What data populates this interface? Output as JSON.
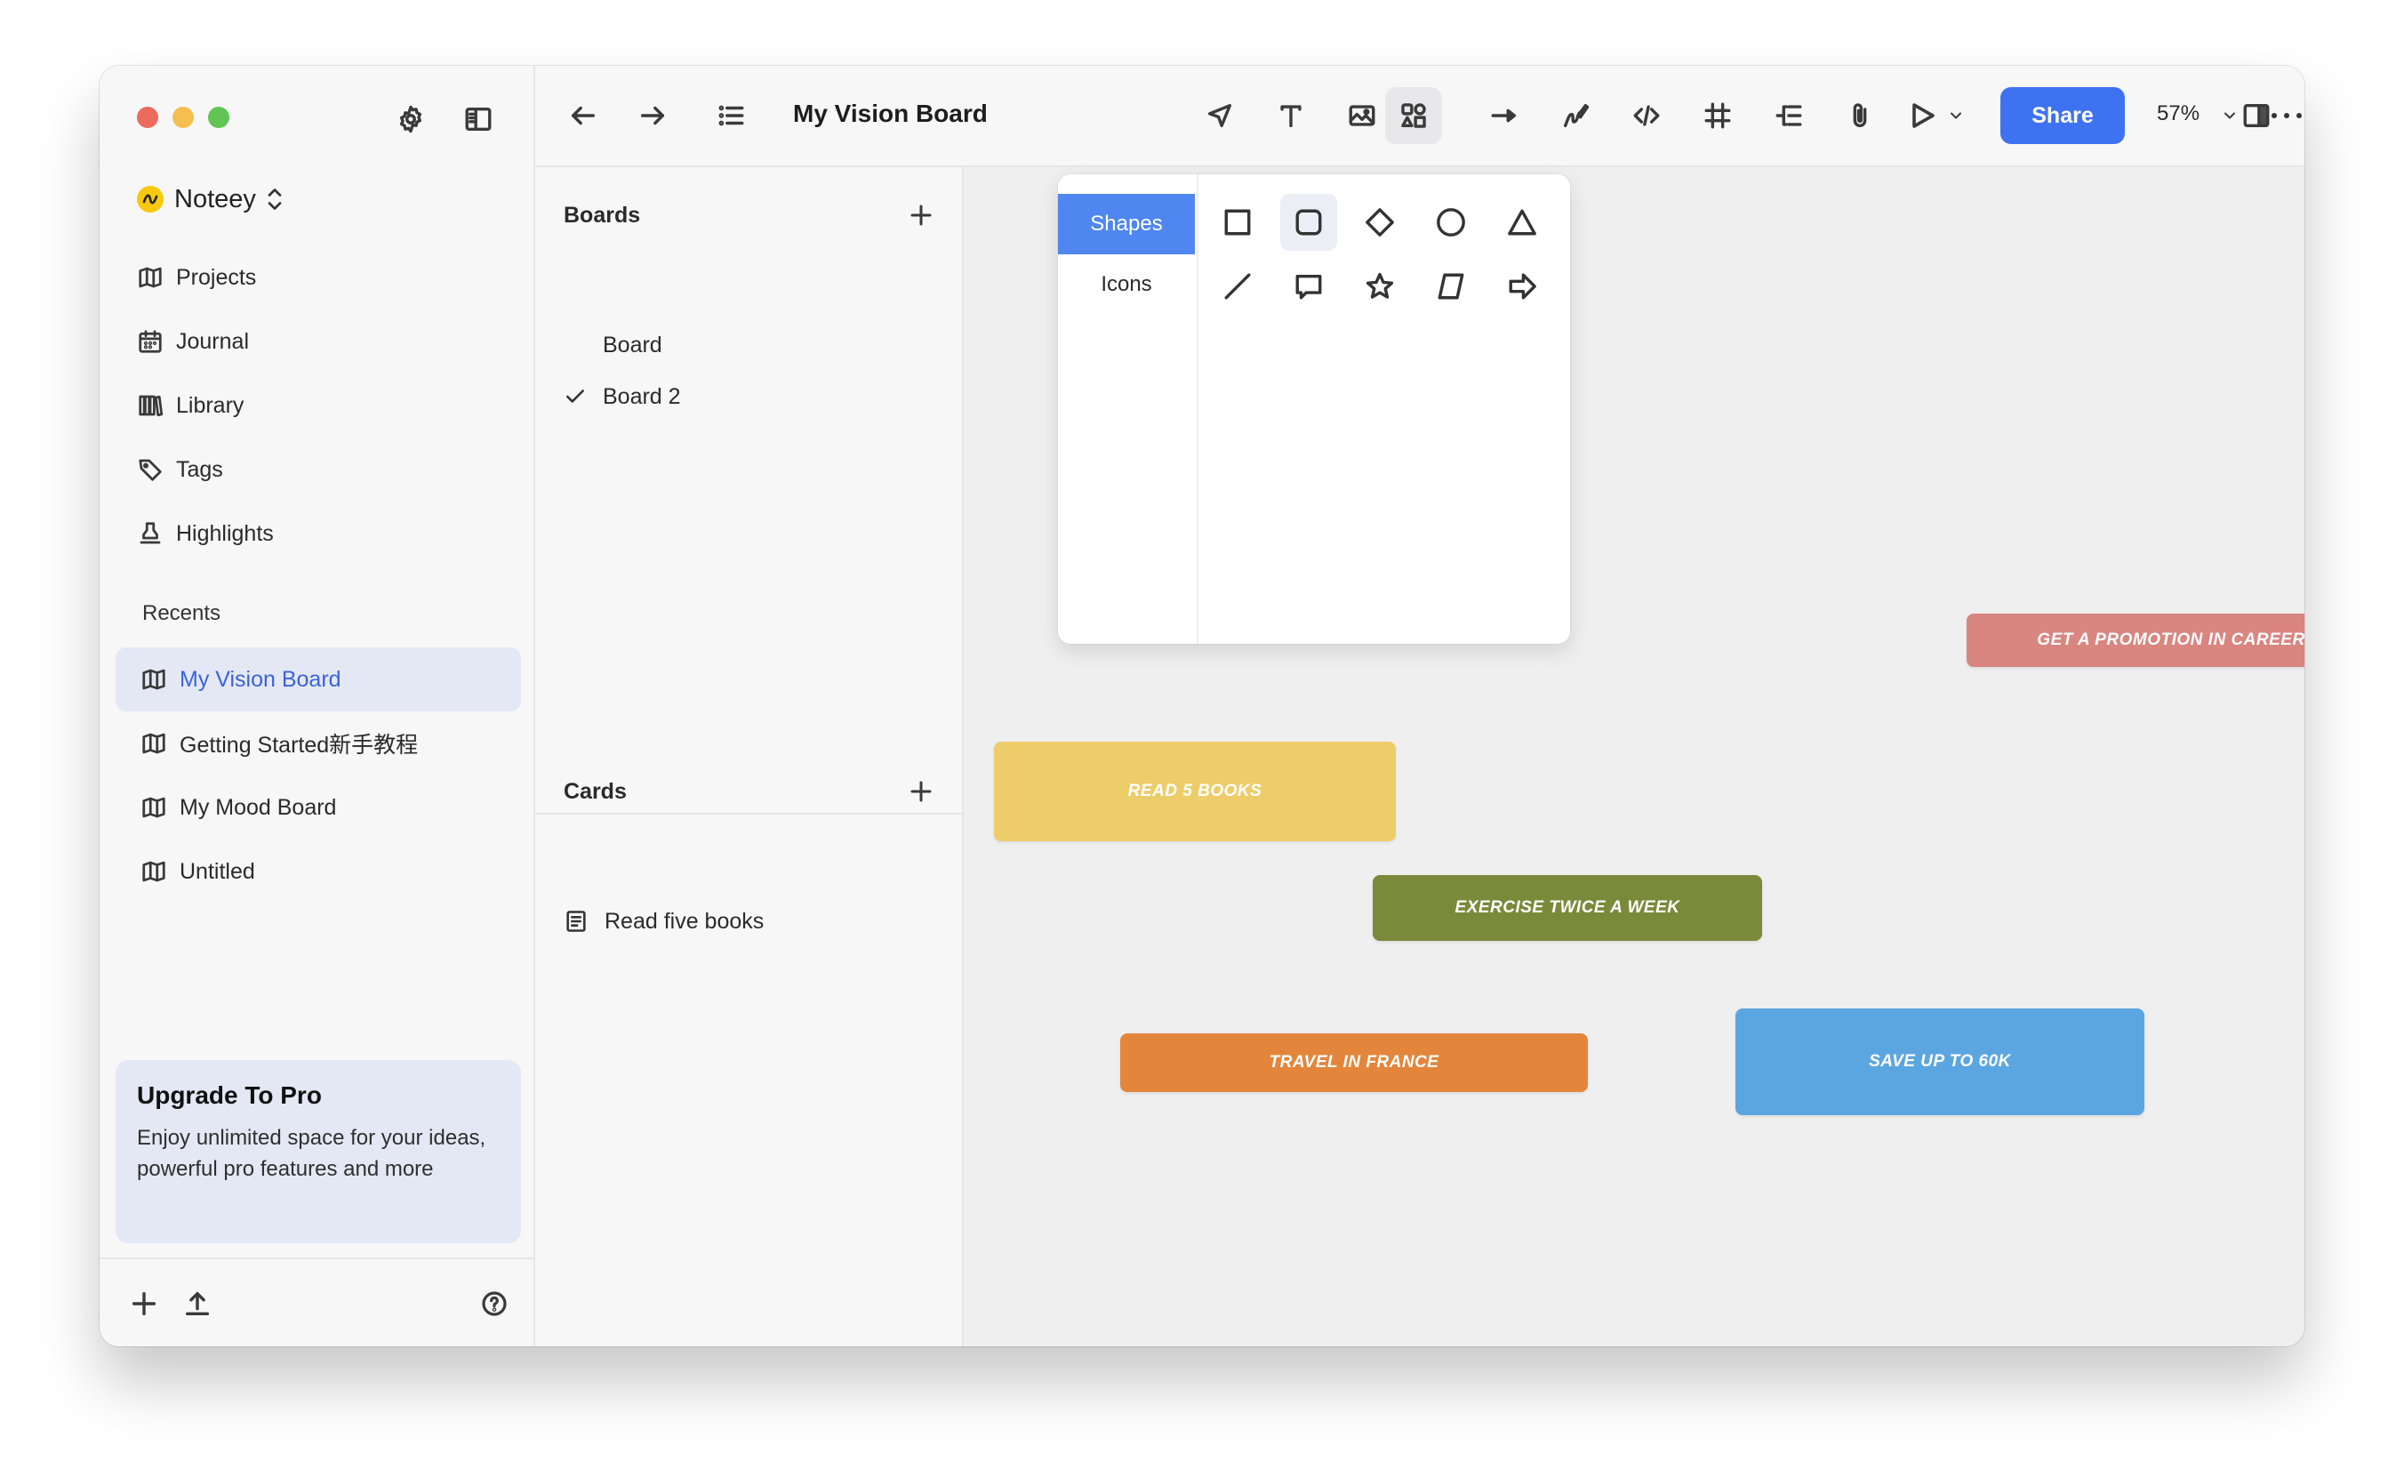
{
  "window": {
    "traffic_colors": {
      "close": "#ec6a5e",
      "minimize": "#f4bf4f",
      "zoom": "#61c554"
    }
  },
  "sidebar": {
    "workspace_name": "Noteey",
    "nav": [
      {
        "label": "Projects",
        "icon": "map-icon"
      },
      {
        "label": "Journal",
        "icon": "calendar-icon"
      },
      {
        "label": "Library",
        "icon": "library-icon"
      },
      {
        "label": "Tags",
        "icon": "tag-icon"
      },
      {
        "label": "Highlights",
        "icon": "highlighter-icon"
      }
    ],
    "recents_label": "Recents",
    "recents": [
      {
        "label": "My Vision Board",
        "active": true
      },
      {
        "label": "Getting Started新手教程",
        "active": false
      },
      {
        "label": "My Mood Board",
        "active": false
      },
      {
        "label": "Untitled",
        "active": false
      }
    ],
    "promo": {
      "title": "Upgrade To Pro",
      "text": "Enjoy unlimited space for your ideas, powerful pro features and more"
    }
  },
  "toolbar": {
    "title": "My Vision Board",
    "share_label": "Share",
    "zoom": "57%",
    "accent": "#3f72f0"
  },
  "panel": {
    "boards_header": "Boards",
    "boards": [
      {
        "label": "Board",
        "checked": false
      },
      {
        "label": "Board 2",
        "checked": true
      }
    ],
    "cards_header": "Cards",
    "cards": [
      {
        "label": "Read five books"
      }
    ]
  },
  "shapes_popover": {
    "tabs": [
      {
        "label": "Shapes",
        "active": true
      },
      {
        "label": "Icons",
        "active": false
      }
    ],
    "shapes_row1": [
      "rectangle",
      "rounded-rectangle",
      "diamond",
      "circle",
      "triangle"
    ],
    "shapes_row2": [
      "line",
      "speech-bubble",
      "star",
      "parallelogram",
      "arrow"
    ]
  },
  "canvas": {
    "cards": [
      {
        "text": "GET A PROMOTION IN CAREER",
        "color": "#d98580"
      },
      {
        "text": "READ 5 BOOKS",
        "color": "#edcd6a"
      },
      {
        "text": "EXERCISE TWICE A WEEK",
        "color": "#7a8a3a"
      },
      {
        "text": "TRAVEL IN FRANCE",
        "color": "#e3863c"
      },
      {
        "text": "SAVE UP TO 60K",
        "color": "#5ba6e0"
      }
    ]
  }
}
